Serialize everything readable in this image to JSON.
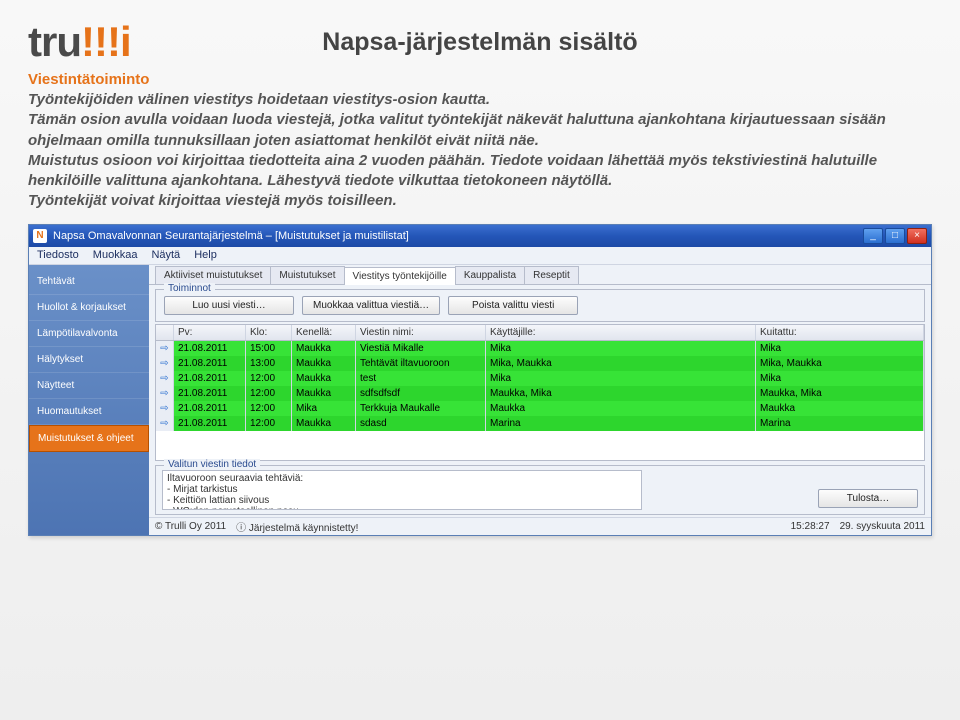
{
  "logo": {
    "plain": "tru",
    "accent": "!!!",
    "accent_sub": "i"
  },
  "page_title": "Napsa-järjestelmän sisältö",
  "section_heading": "Viestintätoiminto",
  "body_text": "Työntekijöiden välinen viestitys hoidetaan viestitys-osion kautta.\nTämän osion avulla voidaan luoda viestejä, jotka valitut työntekijät näkevät haluttuna ajankohtana kirjautuessaan sisään ohjelmaan omilla tunnuksillaan joten asiattomat henkilöt eivät niitä näe.\nMuistutus osioon voi kirjoittaa tiedotteita aina 2 vuoden päähän. Tiedote voidaan lähettää myös tekstiviestinä halutuille henkilöille valittuna ajankohtana. Lähestyvä tiedote vilkuttaa tietokoneen näytöllä.\nTyöntekijät voivat kirjoittaa viestejä myös toisilleen.",
  "app": {
    "title": "Napsa Omavalvonnan Seurantajärjestelmä – [Muistutukset ja muistilistat]",
    "menus": [
      "Tiedosto",
      "Muokkaa",
      "Näytä",
      "Help"
    ],
    "sidebar": [
      {
        "label": "Tehtävät"
      },
      {
        "label": "Huollot & korjaukset"
      },
      {
        "label": "Lämpötilavalvonta"
      },
      {
        "label": "Hälytykset"
      },
      {
        "label": "Näytteet"
      },
      {
        "label": "Huomautukset"
      },
      {
        "label": "Muistutukset & ohjeet",
        "active": true
      }
    ],
    "tabs": [
      {
        "label": "Aktiiviset muistutukset"
      },
      {
        "label": "Muistutukset"
      },
      {
        "label": "Viestitys työntekijöille",
        "active": true
      },
      {
        "label": "Kauppalista"
      },
      {
        "label": "Reseptit"
      }
    ],
    "toolbar": {
      "legend": "Toiminnot",
      "buttons": [
        "Luo uusi viesti…",
        "Muokkaa valittua viestiä…",
        "Poista valittu viesti"
      ]
    },
    "grid": {
      "headers": {
        "pv": "Pv:",
        "klo": "Klo:",
        "kenella": "Kenellä:",
        "nimi": "Viestin nimi:",
        "kayttajille": "Käyttäjille:",
        "kuitattu": "Kuitattu:"
      },
      "rows": [
        {
          "pv": "21.08.2011",
          "klo": "15:00",
          "ken": "Maukka",
          "nimi": "Viestiä Mikalle",
          "kayt": "Mika",
          "kuit": "Mika"
        },
        {
          "pv": "21.08.2011",
          "klo": "13:00",
          "ken": "Maukka",
          "nimi": "Tehtävät iltavuoroon",
          "kayt": "Mika, Maukka",
          "kuit": "Mika, Maukka"
        },
        {
          "pv": "21.08.2011",
          "klo": "12:00",
          "ken": "Maukka",
          "nimi": "test",
          "kayt": "Mika",
          "kuit": "Mika"
        },
        {
          "pv": "21.08.2011",
          "klo": "12:00",
          "ken": "Maukka",
          "nimi": "sdfsdfsdf",
          "kayt": "Maukka, Mika",
          "kuit": "Maukka, Mika"
        },
        {
          "pv": "21.08.2011",
          "klo": "12:00",
          "ken": "Mika",
          "nimi": "Terkkuja Maukalle",
          "kayt": "Maukka",
          "kuit": "Maukka"
        },
        {
          "pv": "21.08.2011",
          "klo": "12:00",
          "ken": "Maukka",
          "nimi": "sdasd",
          "kayt": "Marina",
          "kuit": "Marina"
        }
      ]
    },
    "detail": {
      "legend": "Valitun viestin tiedot",
      "text": "Iltavuoroon seuraavia tehtäviä:\n- Mirjat tarkistus\n- Keittiön lattian siivous\n- WC:den perusteellinen pesu",
      "print": "Tulosta…"
    },
    "status": {
      "copyright": "© Trulli Oy 2011",
      "running": "Järjestelmä käynnistetty!",
      "time": "15:28:27",
      "date": "29. syyskuuta 2011"
    }
  }
}
